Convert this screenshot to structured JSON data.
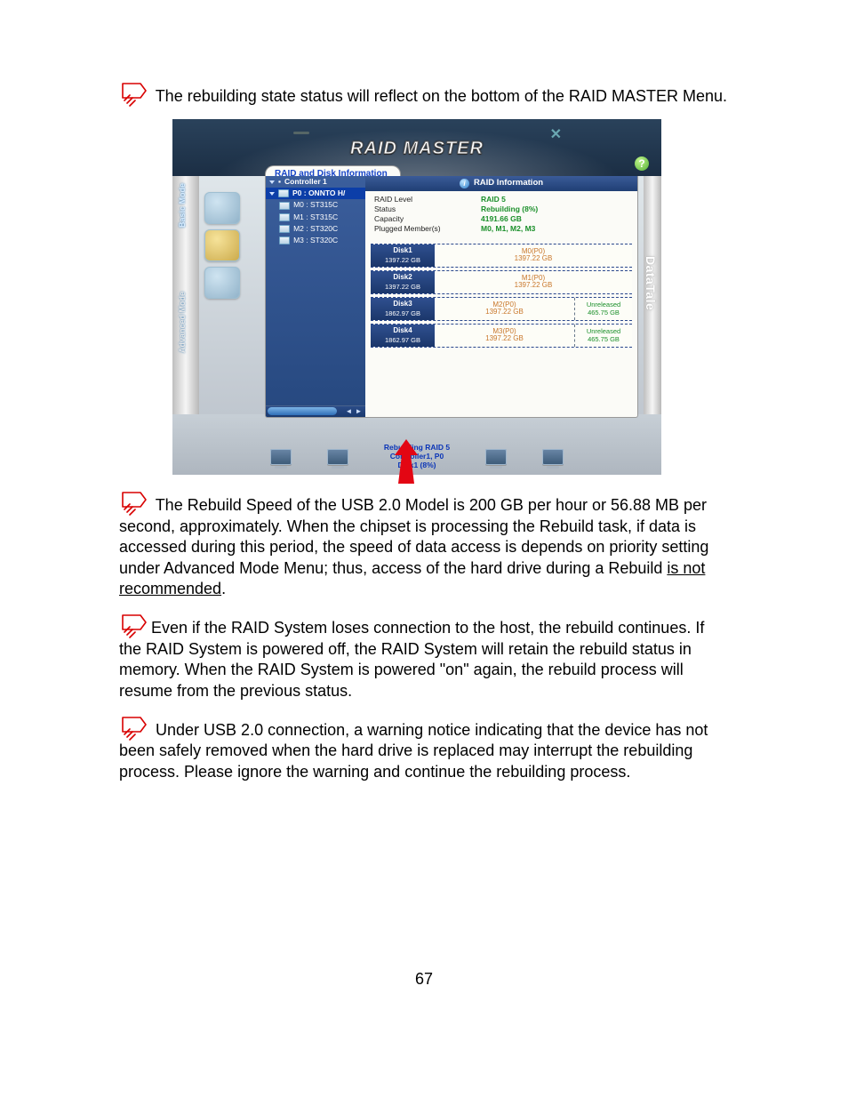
{
  "note1": "The rebuilding state status will reflect on the bottom of the RAID MASTER Menu.",
  "note2_a": "The Rebuild Speed of the USB 2.0 Model is 200 GB per hour or 56.88 MB per second, approximately.  When the chipset is processing the Rebuild task, if data is accessed during this period, the speed of data access is depends on priority setting under Advanced Mode Menu; thus, access of the hard drive during a Rebuild ",
  "note2_u": "is not recommended",
  "note3": "Even if the RAID System loses connection to the host, the rebuild continues.  If the RAID System is powered off, the RAID System will retain the rebuild status in memory.  When the RAID System is powered \"on\" again, the rebuild process will resume from the previous status.",
  "note4": "Under USB 2.0 connection, a warning notice indicating that the device has not been safely removed when the hard drive is replaced may interrupt the rebuilding process.  Please ignore the warning and continue the rebuilding process.",
  "pagenum": "67",
  "app": {
    "title": "RAID MASTER",
    "brand": "DataTale",
    "side_basic": "Basic Mode",
    "side_adv": "Advanced Mode",
    "tab": "RAID and Disk Information",
    "tree": {
      "controller": "Controller 1",
      "p0": "P0 : ONNTO H/",
      "members": [
        "M0 : ST315C",
        "M1 : ST315C",
        "M2 : ST320C",
        "M3 : ST320C"
      ]
    },
    "info": {
      "title": "RAID Information",
      "rows": [
        {
          "k": "RAID Level",
          "v": "RAID 5"
        },
        {
          "k": "Status",
          "v": "Rebuilding (8%)"
        },
        {
          "k": "Capacity",
          "v": "4191.66 GB"
        },
        {
          "k": "Plugged Member(s)",
          "v": "M0, M1, M2, M3"
        }
      ]
    },
    "disks": [
      {
        "name": "Disk1",
        "size": "1397.22 GB",
        "slot": "M0(P0)",
        "slot_sz": "1397.22 GB",
        "unrel": false
      },
      {
        "name": "Disk2",
        "size": "1397.22 GB",
        "slot": "M1(P0)",
        "slot_sz": "1397.22 GB",
        "unrel": false
      },
      {
        "name": "Disk3",
        "size": "1862.97 GB",
        "slot": "M2(P0)",
        "slot_sz": "1397.22 GB",
        "unrel": true,
        "unrel_lbl": "Unreleased",
        "unrel_sz": "465.75 GB"
      },
      {
        "name": "Disk4",
        "size": "1862.97 GB",
        "slot": "M3(P0)",
        "slot_sz": "1397.22 GB",
        "unrel": true,
        "unrel_lbl": "Unreleased",
        "unrel_sz": "465.75 GB"
      }
    ],
    "status": {
      "l1": "Rebuilding RAID 5",
      "l2": "Controller1, P0",
      "l3": "Disk1 (8%)"
    }
  }
}
